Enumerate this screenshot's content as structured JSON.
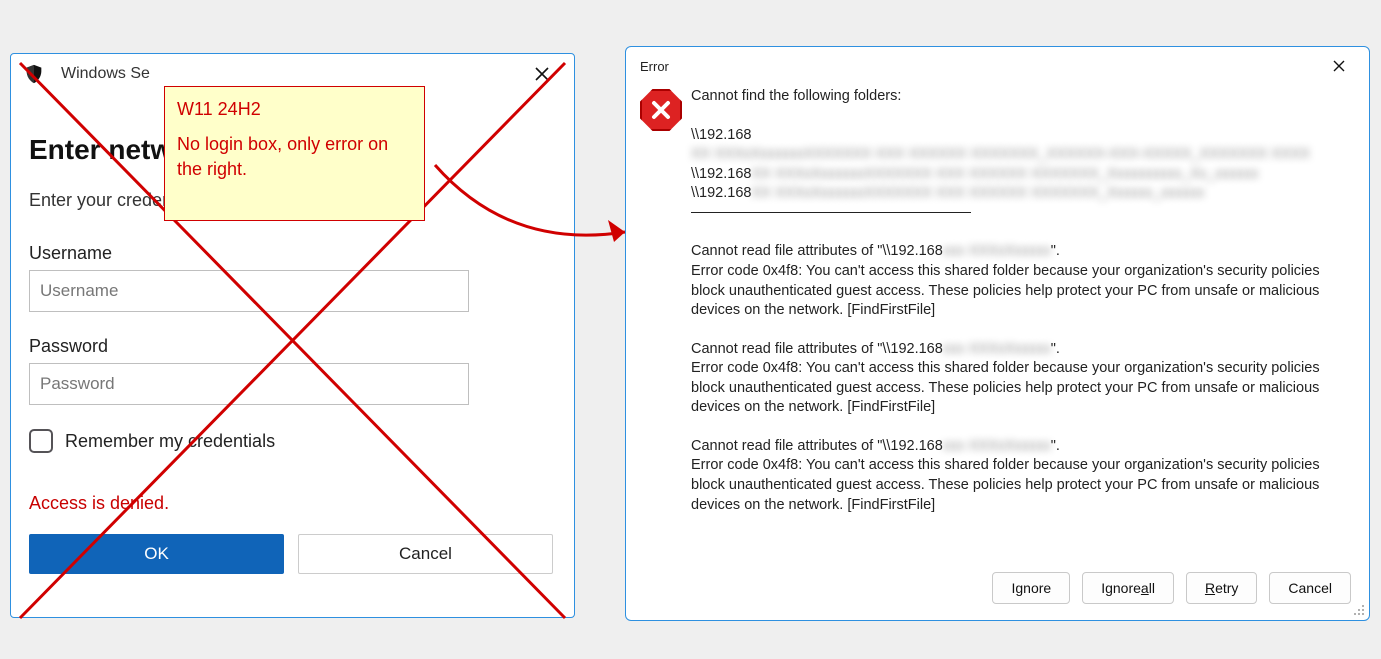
{
  "credential_dialog": {
    "window_title": "Windows Se",
    "heading": "Enter netwo",
    "subheading": "Enter your creden",
    "username_label": "Username",
    "username_placeholder": "Username",
    "password_label": "Password",
    "password_placeholder": "Password",
    "remember_label": "Remember my credentials",
    "error_text": "Access is denied.",
    "ok_label": "OK",
    "cancel_label": "Cancel"
  },
  "annotation": {
    "line1": "W11 24H2",
    "line2": "No login box, only error on the right."
  },
  "error_dialog": {
    "title": "Error",
    "intro": "Cannot find the following folders:",
    "paths_prefix": "\\\\192.168",
    "path_blur1": "XX XXXxXxxxxxxXXXXXXX XXX XXXXXX XXXXXXX_XXXXXX-XXX-XXXXX_XXXXXXX XXXX",
    "path_blur2": "XX XXXxXxxxxxxXXXXXXX XXX XXXXXX XXXXXXX_Xxxxxxxxxx_Xx_xxxxxx",
    "path_blur3": "XX XXXxXxxxxxxXXXXXXX XXX XXXXXX XXXXXXX_Xxxxxx_xxxxxx",
    "attr_prefix": "Cannot read file attributes of \"\\\\192.168",
    "attr_blur": "xxx XXXxXxxxxx",
    "attr_suffix": "\".",
    "error_message": "Error code 0x4f8: You can't access this shared folder because your organization's security policies block unauthenticated guest access. These policies help protect your PC from unsafe or malicious devices on the network. [FindFirstFile]",
    "buttons": {
      "ignore_pre": "I",
      "ignore_u": "g",
      "ignore_post": "nore",
      "ignoreall_pre": "Ignore ",
      "ignoreall_u": "a",
      "ignoreall_post": "ll",
      "retry_pre": "",
      "retry_u": "R",
      "retry_post": "etry",
      "cancel": "Cancel"
    }
  }
}
